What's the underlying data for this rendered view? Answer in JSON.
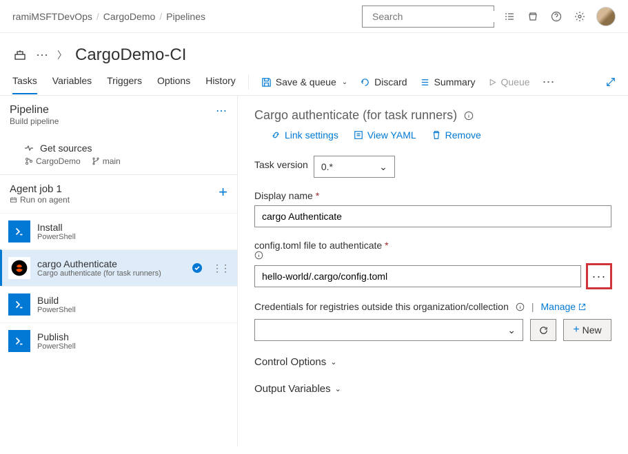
{
  "top": {
    "breadcrumb": [
      "ramiMSFTDevOps",
      "CargoDemo",
      "Pipelines"
    ],
    "search_placeholder": "Search"
  },
  "subheader": {
    "title": "CargoDemo-CI"
  },
  "tabs": {
    "items": [
      "Tasks",
      "Variables",
      "Triggers",
      "Options",
      "History"
    ],
    "active": "Tasks"
  },
  "toolbar": {
    "save_queue": "Save & queue",
    "discard": "Discard",
    "summary": "Summary",
    "queue": "Queue"
  },
  "left": {
    "pipeline_title": "Pipeline",
    "pipeline_sub": "Build pipeline",
    "get_sources": "Get sources",
    "repo": "CargoDemo",
    "branch": "main",
    "agent_job": "Agent job 1",
    "agent_sub": "Run on agent",
    "tasks": [
      {
        "name": "Install",
        "sub": "PowerShell",
        "icon": "ps"
      },
      {
        "name": "cargo Authenticate",
        "sub": "Cargo authenticate (for task runners)",
        "icon": "cargo",
        "selected": true
      },
      {
        "name": "Build",
        "sub": "PowerShell",
        "icon": "ps"
      },
      {
        "name": "Publish",
        "sub": "PowerShell",
        "icon": "ps"
      }
    ]
  },
  "right": {
    "title": "Cargo authenticate (for task runners)",
    "links": {
      "link": "Link settings",
      "yaml": "View YAML",
      "remove": "Remove"
    },
    "task_version_label": "Task version",
    "task_version_value": "0.*",
    "display_name_label": "Display name",
    "display_name_value": "cargo Authenticate",
    "config_label": "config.toml file to authenticate",
    "config_value": "hello-world/.cargo/config.toml",
    "cred_label": "Credentials for registries outside this organization/collection",
    "manage": "Manage",
    "new": "New",
    "control_options": "Control Options",
    "output_vars": "Output Variables"
  }
}
